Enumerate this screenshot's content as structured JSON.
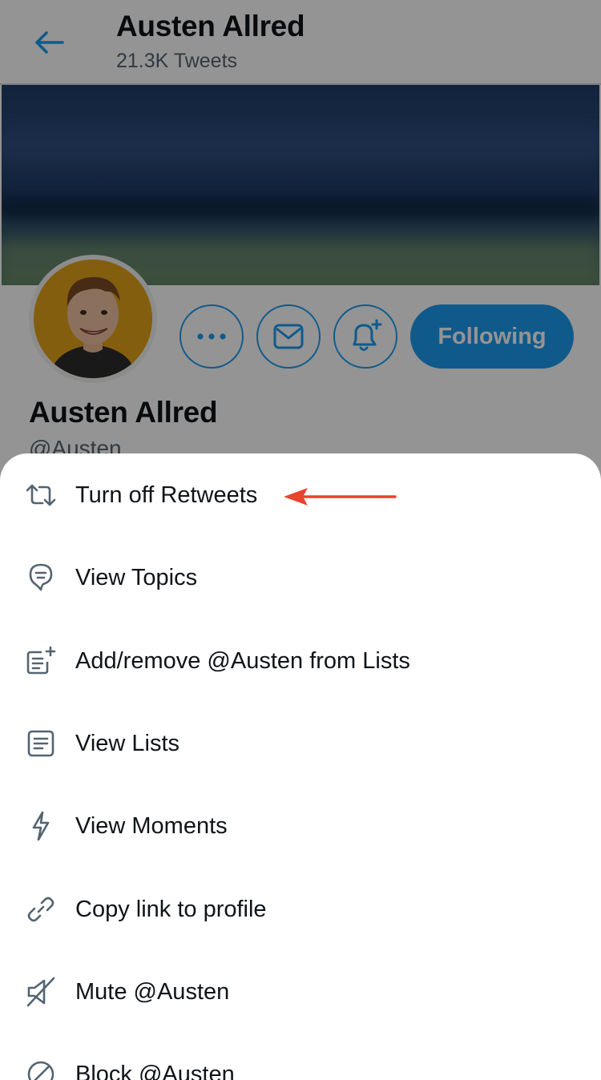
{
  "header": {
    "name": "Austen Allred",
    "tweet_count": "21.3K Tweets"
  },
  "profile": {
    "name": "Austen Allred",
    "handle": "@Austen",
    "following_label": "Following"
  },
  "menu": {
    "items": [
      {
        "label": "Turn off Retweets",
        "icon": "retweet-icon"
      },
      {
        "label": "View Topics",
        "icon": "topics-icon"
      },
      {
        "label": "Add/remove @Austen from Lists",
        "icon": "list-add-icon"
      },
      {
        "label": "View Lists",
        "icon": "list-icon"
      },
      {
        "label": "View Moments",
        "icon": "lightning-icon"
      },
      {
        "label": "Copy link to profile",
        "icon": "link-icon"
      },
      {
        "label": "Mute @Austen",
        "icon": "mute-icon"
      },
      {
        "label": "Block @Austen",
        "icon": "block-icon"
      }
    ]
  },
  "colors": {
    "accent": "#1d9bf0",
    "annotation_arrow": "#e8432e",
    "icon_gray": "#536471"
  }
}
